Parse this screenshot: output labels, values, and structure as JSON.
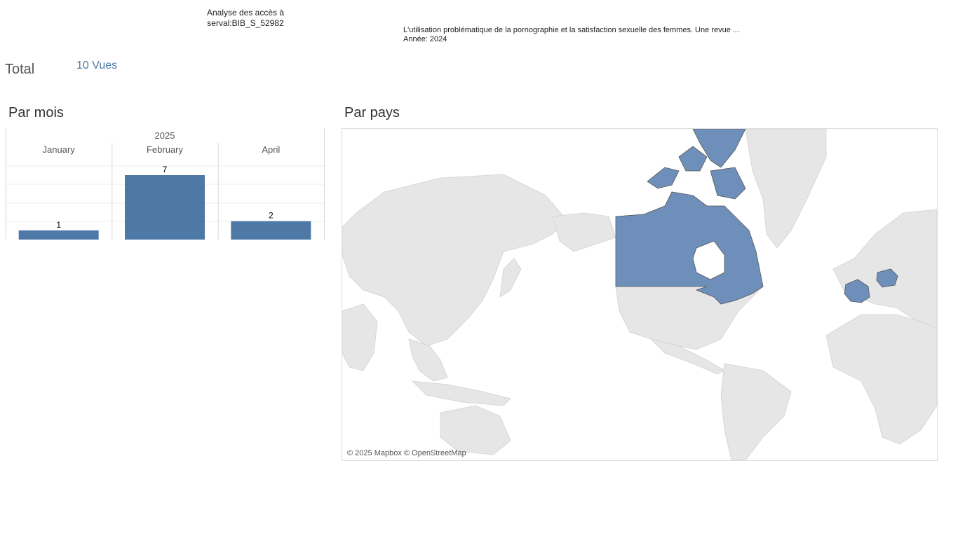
{
  "header": {
    "report_title_line1": "Analyse des accès à",
    "report_title_line2": "serval:BIB_S_52982",
    "doc_title": "L'utilisation problématique de la pornographie et la satisfaction sexuelle des femmes. Une revue ...",
    "doc_year": "Année: 2024"
  },
  "total": {
    "label": "Total",
    "value": "10 Vues"
  },
  "sections": {
    "by_month": "Par mois",
    "by_country": "Par pays"
  },
  "colors": {
    "bar": "#4e79a7",
    "map_highlight": "#6f8fbb",
    "map_land": "#e6e6e6"
  },
  "chart_data": {
    "type": "bar",
    "group_label": "2025",
    "categories": [
      "January",
      "February",
      "April"
    ],
    "values": [
      1,
      7,
      2
    ],
    "data_labels": [
      "1",
      "7",
      "2"
    ],
    "ylim": [
      0,
      7
    ],
    "grid": true
  },
  "map": {
    "highlighted_countries": [
      "Canada",
      "France",
      "Poland"
    ],
    "attribution": "© 2025 Mapbox © OpenStreetMap"
  }
}
